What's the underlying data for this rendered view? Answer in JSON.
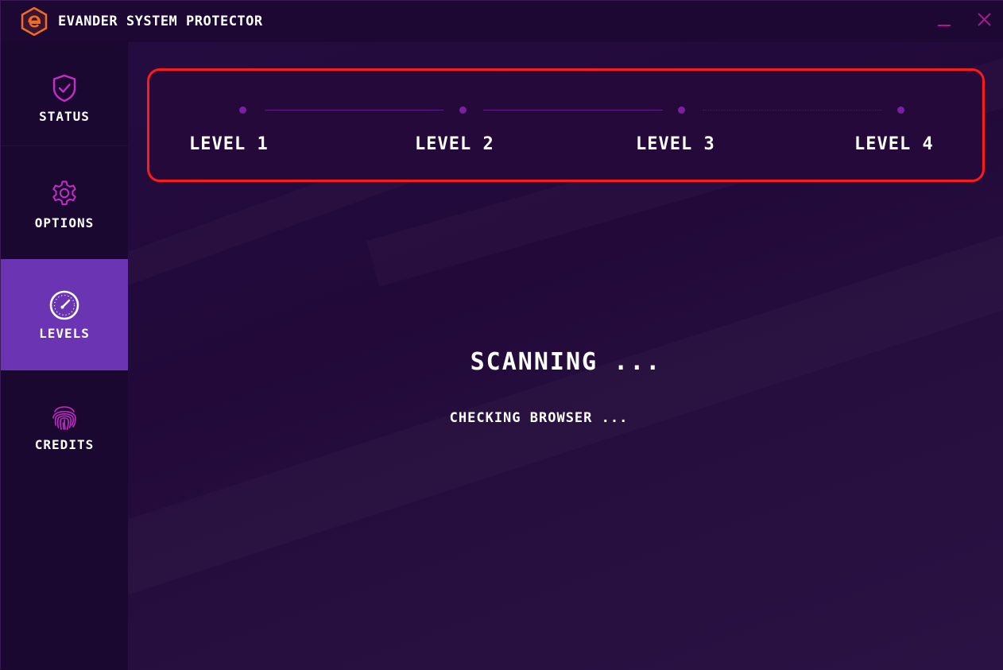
{
  "app": {
    "title": "EVANDER SYSTEM PROTECTOR",
    "logo_icon": "evander-e-logo-icon"
  },
  "window_controls": {
    "minimize_icon": "minimize-icon",
    "close_icon": "close-icon"
  },
  "sidebar": {
    "items": [
      {
        "label": "STATUS",
        "icon": "shield-check-icon",
        "active": false
      },
      {
        "label": "OPTIONS",
        "icon": "gear-icon",
        "active": false
      },
      {
        "label": "LEVELS",
        "icon": "gauge-icon",
        "active": true
      },
      {
        "label": "CREDITS",
        "icon": "fingerprint-icon",
        "active": false
      }
    ]
  },
  "levels": {
    "items": [
      {
        "label": "LEVEL 1"
      },
      {
        "label": "LEVEL 2"
      },
      {
        "label": "LEVEL 3"
      },
      {
        "label": "LEVEL 4"
      }
    ]
  },
  "scan": {
    "title": "SCANNING ...",
    "status": "CHECKING BROWSER ..."
  },
  "colors": {
    "accent": "#6a34b3",
    "highlight_border": "#ff1a1a",
    "icon_magenta": "#c42bc8",
    "logo_orange": "#f06a28",
    "background": "#21093a"
  }
}
